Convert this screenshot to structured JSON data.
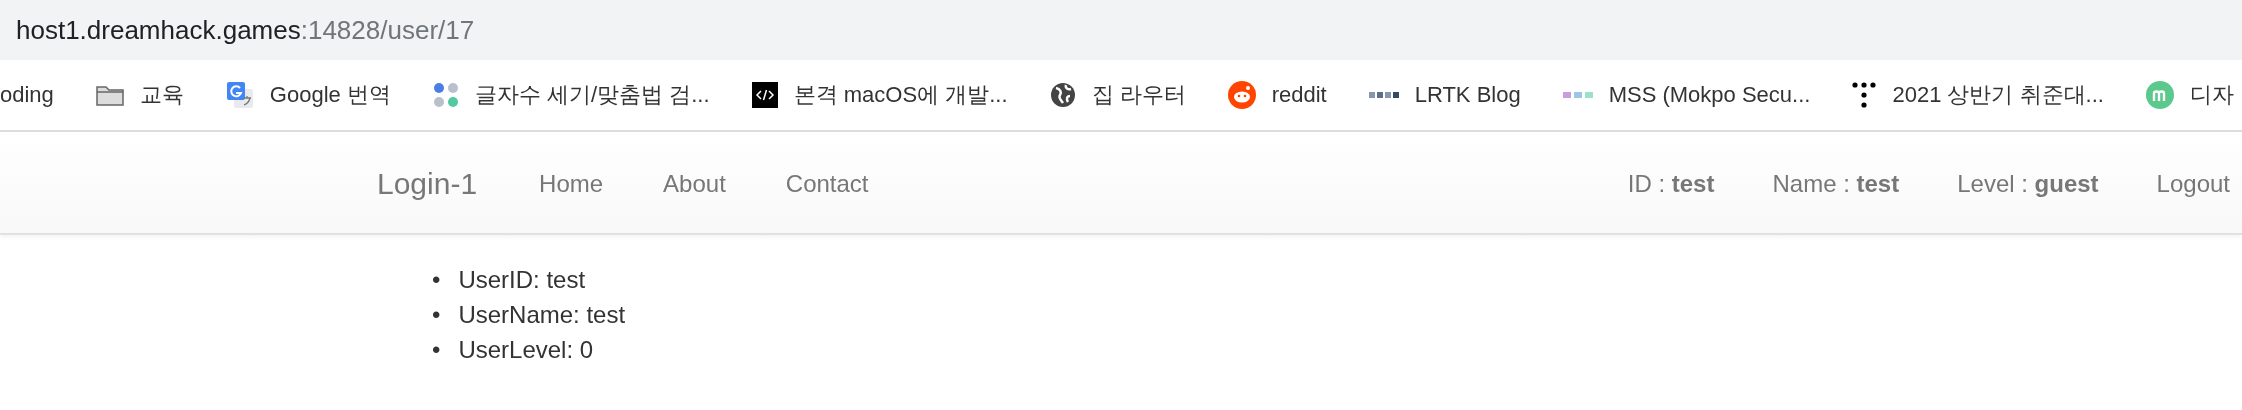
{
  "address_bar": {
    "host": "host1.dreamhack.games",
    "path": ":14828/user/17"
  },
  "bookmarks": [
    {
      "kind": "none",
      "label": "oding"
    },
    {
      "kind": "folder",
      "label": "교육"
    },
    {
      "kind": "translate",
      "label": "Google 번역"
    },
    {
      "kind": "dots4",
      "label": "글자수 세기/맞춤법 검..."
    },
    {
      "kind": "code",
      "label": "본격 macOS에 개발..."
    },
    {
      "kind": "globe",
      "label": "집 라우터"
    },
    {
      "kind": "reddit",
      "label": "reddit"
    },
    {
      "kind": "lrtk",
      "label": "LRTK Blog"
    },
    {
      "kind": "mss",
      "label": "MSS (Mokpo Secu..."
    },
    {
      "kind": "dots5",
      "label": "2021 상반기 취준대..."
    },
    {
      "kind": "m",
      "label": "디자"
    }
  ],
  "navbar": {
    "brand": "Login-1",
    "links": [
      "Home",
      "About",
      "Contact"
    ],
    "user_info": [
      "ID : **test**",
      "Name : **test**",
      "Level : **guest**"
    ],
    "logout": "Logout"
  },
  "user_details": [
    {
      "marker": "•",
      "text": "UserID: test"
    },
    {
      "marker": "•",
      "text": "UserName: test"
    },
    {
      "marker": "•",
      "text": "UserLevel: 0"
    }
  ]
}
